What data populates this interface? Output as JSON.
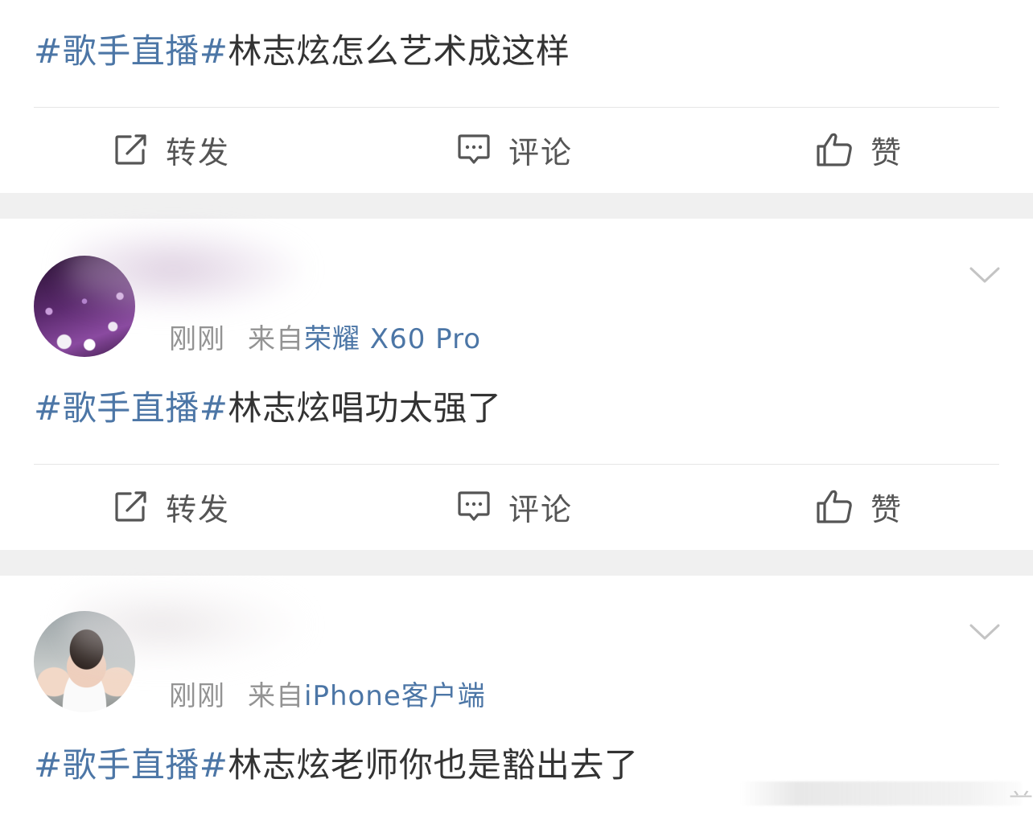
{
  "posts": [
    {
      "topic": "#歌手直播#",
      "text": "林志炫怎么艺术成这样",
      "actions": {
        "repost": "转发",
        "comment": "评论",
        "like": "赞"
      }
    },
    {
      "avatar": "avatar-purple-flowers",
      "time": "刚刚",
      "source_prefix": "来自",
      "source": "荣耀 X60 Pro",
      "topic": "#歌手直播#",
      "text": "林志炫唱功太强了",
      "actions": {
        "repost": "转发",
        "comment": "评论",
        "like": "赞"
      }
    },
    {
      "avatar": "avatar-woman-photo",
      "time": "刚刚",
      "source_prefix": "来自",
      "source": "iPhone客户端",
      "topic": "#歌手直播#",
      "text": "林志炫老师你也是豁出去了"
    }
  ],
  "icons": {
    "repost": "share-square-icon",
    "comment": "comment-bubble-icon",
    "like": "thumbs-up-icon",
    "menu": "chevron-down-icon"
  },
  "colors": {
    "topic": "#4c76a6",
    "text": "#333333",
    "meta": "#939393",
    "separator": "#f0f0f0"
  }
}
